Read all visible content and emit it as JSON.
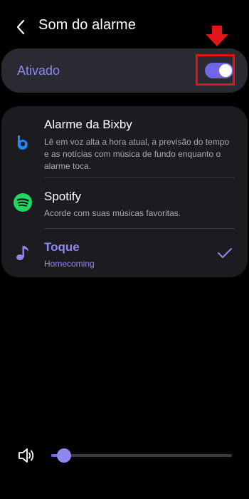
{
  "header": {
    "title": "Som do alarme"
  },
  "master_toggle": {
    "label": "Ativado",
    "on": true
  },
  "options": [
    {
      "icon": "bixby-icon",
      "title": "Alarme da Bixby",
      "subtitle": "Lê em voz alta a hora atual, a previsão do tempo e as notícias com música de fundo enquanto o alarme toca.",
      "selected": false
    },
    {
      "icon": "spotify-icon",
      "title": "Spotify",
      "subtitle": "Acorde com suas músicas favoritas.",
      "selected": false
    },
    {
      "icon": "music-note-icon",
      "title": "Toque",
      "subtitle": "Homecoming",
      "selected": true
    }
  ],
  "volume": {
    "icon": "speaker-icon",
    "level": 0.05
  },
  "colors": {
    "accent": "#8f87f2",
    "toggle_on": "#6f67e6",
    "spotify_green": "#1ed760",
    "bixby_blue": "#1a8cff",
    "annotation_red": "#e0161b"
  }
}
